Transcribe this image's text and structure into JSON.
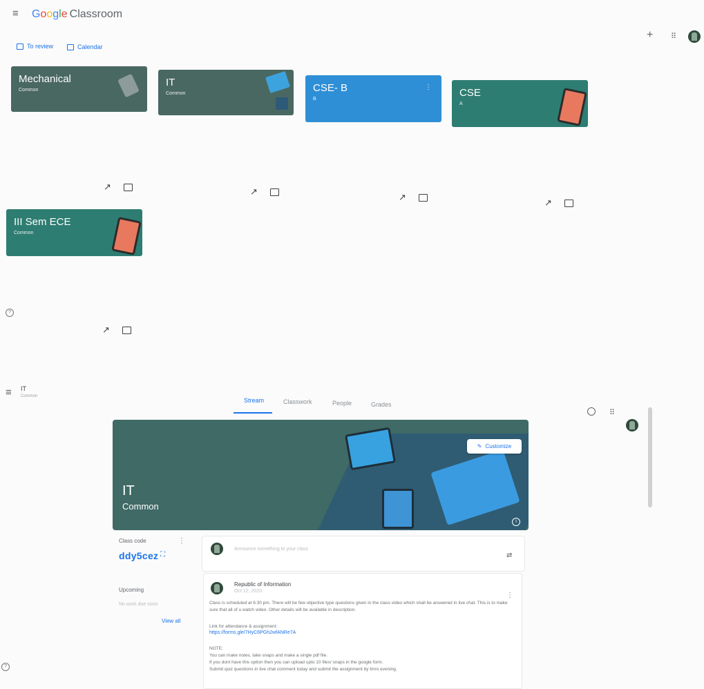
{
  "top": {
    "brand": {
      "google": "Google",
      "classroom": "Classroom"
    },
    "to_review": "To review",
    "calendar": "Calendar",
    "add_symbol": "+",
    "cards": [
      {
        "name": "Mechanical",
        "section": "Common",
        "color": "#4a6862"
      },
      {
        "name": "IT",
        "section": "Common",
        "color": "#4a6862"
      },
      {
        "name": "CSE- B",
        "section": "B",
        "color": "#2f8fd6"
      },
      {
        "name": "CSE",
        "section": "A",
        "color": "#2e7d72"
      },
      {
        "name": "III Sem ECE",
        "section": "Common",
        "color": "#2e7d72"
      }
    ]
  },
  "bottom": {
    "class_name": "IT",
    "class_section": "Common",
    "tabs": [
      "Stream",
      "Classwork",
      "People",
      "Grades"
    ],
    "active_tab": "Stream",
    "banner": {
      "title": "IT",
      "subtitle": "Common",
      "customize": "Customize"
    },
    "class_code_label": "Class code",
    "class_code": "ddy5cez",
    "upcoming_label": "Upcoming",
    "upcoming_empty": "No work due soon",
    "view_all": "View all",
    "announce_placeholder": "Announce something to your class",
    "post": {
      "author": "Republic of Information",
      "date": "Oct 12, 2020",
      "body1": "Class is scheduled at 6:30 pm. There will be few objective type questions given in the class video which shall be answered in live chat. This is to make sure that all of u watch video. Other details will be available in description.",
      "link_label": "Link for attendance & assignment:",
      "link": "https://forms.gle/7HyC6PGh2wfANRe7A",
      "note": "NOTE:",
      "line1": "You can make notes, take snaps and make a single pdf file.",
      "line2": "If you dont have this option then you can upload upto 10 files/ snaps in the google form.",
      "line3": "Submit quiz questions in live chat comment today and submit the assignment by tmro evening."
    }
  },
  "colors": {
    "accent": "#1a73e8",
    "teal": "#2e7d72",
    "slate": "#4a6862",
    "blue": "#2f8fd6"
  }
}
